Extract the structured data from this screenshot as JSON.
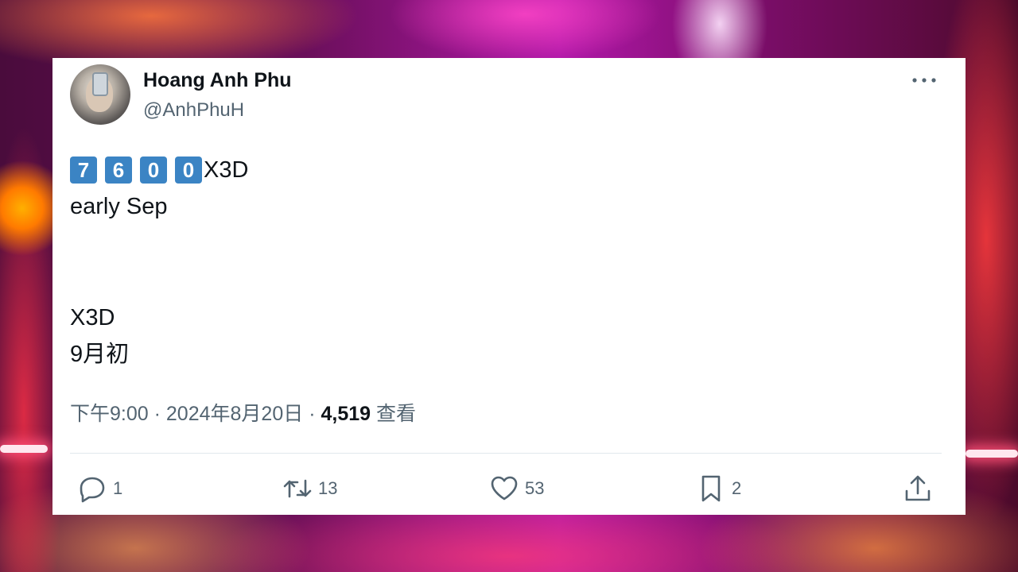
{
  "tweet": {
    "author_name": "Hoang Anh Phu",
    "handle": "@AnhPhuH",
    "keycap_digits": [
      "7",
      "6",
      "0",
      "0"
    ],
    "line1_suffix": "X3D",
    "line2": "early Sep",
    "line3": "X3D",
    "line4": "9月初",
    "time": "下午9:00",
    "separator": "·",
    "date": "2024年8月20日",
    "views_count": "4,519",
    "views_label": "查看",
    "actions": {
      "reply_count": "1",
      "retweet_count": "13",
      "like_count": "53",
      "bookmark_count": "2"
    }
  },
  "icons": [
    "more-icon",
    "reply-icon",
    "retweet-icon",
    "like-icon",
    "bookmark-icon",
    "share-icon"
  ],
  "colors": {
    "keycap_blue": "#3b84c4",
    "text_primary": "#0f1419",
    "text_secondary": "#536471"
  }
}
